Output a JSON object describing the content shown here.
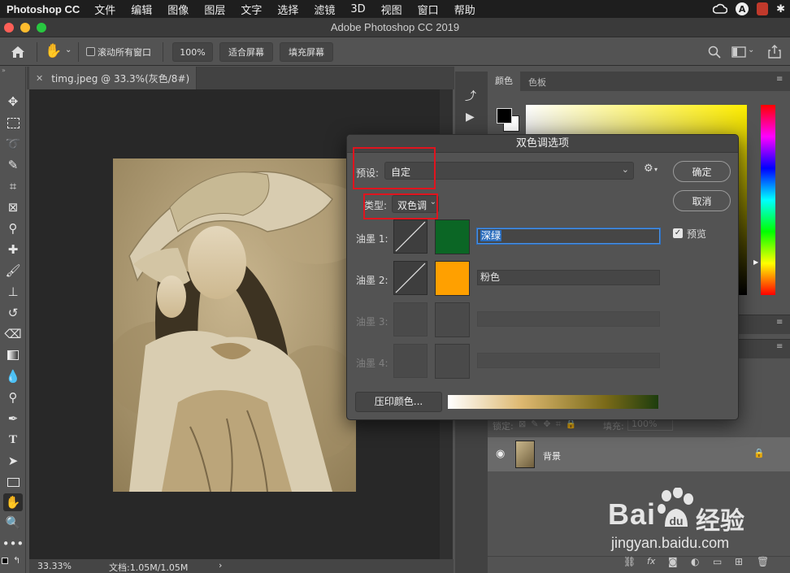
{
  "menubar": {
    "app_name": "Photoshop CC",
    "items": [
      "文件",
      "编辑",
      "图像",
      "图层",
      "文字",
      "选择",
      "滤镜",
      "3D",
      "视图",
      "窗口",
      "帮助"
    ],
    "right_items": [
      "A"
    ]
  },
  "window": {
    "title": "Adobe Photoshop CC 2019"
  },
  "options_bar": {
    "scroll_all_label": "滚动所有窗口",
    "zoom_value": "100%",
    "fit_screen_label": "适合屏幕",
    "fill_screen_label": "填充屏幕"
  },
  "document": {
    "tab_title": "timg.jpeg @ 33.3%(灰色/8#)",
    "zoom_status": "33.33%",
    "doc_size": "文档:1.05M/1.05M"
  },
  "panels": {
    "color_tab": "颜色",
    "swatches_tab": "色板",
    "lock_label": "锁定:",
    "fill_label": "填充:",
    "fill_value": "100%",
    "layer_name": "背景"
  },
  "dialog": {
    "title": "双色调选项",
    "preset_label": "预设:",
    "preset_value": "自定",
    "type_label": "类型:",
    "type_value": "双色调",
    "ink1_label": "油墨 1:",
    "ink1_name": "深绿",
    "ink1_color": "#0b6625",
    "ink2_label": "油墨 2:",
    "ink2_name": "粉色",
    "ink2_color": "#ffa000",
    "ink3_label": "油墨 3:",
    "ink4_label": "油墨 4:",
    "ok_label": "确定",
    "cancel_label": "取消",
    "preview_label": "预览",
    "preview_checked": true,
    "overprint_label": "压印颜色..."
  },
  "watermark": {
    "brand_left": "Bai",
    "brand_right": "经验",
    "url": "jingyan.baidu.com"
  }
}
